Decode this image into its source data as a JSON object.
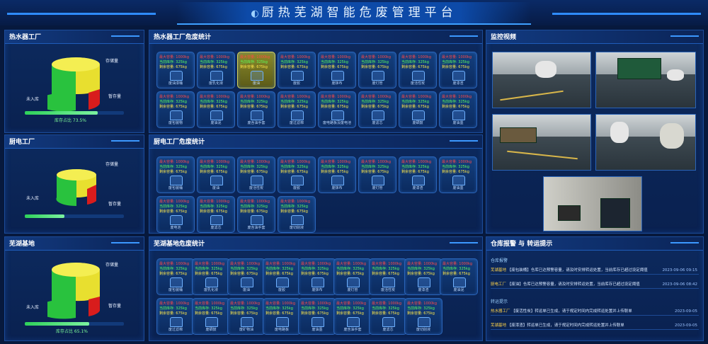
{
  "header": {
    "title": "厨热芜湖智能危废管理平台"
  },
  "panels": {
    "p1": {
      "title": "热水器工厂"
    },
    "p2": {
      "title": "厨电工厂"
    },
    "p3": {
      "title": "芜湖基地"
    },
    "p4": {
      "title": "热水器工厂危废统计"
    },
    "p5": {
      "title": "厨电工厂危废统计"
    },
    "p6": {
      "title": "芜湖基地危废统计"
    },
    "p7": {
      "title": "监控视频"
    },
    "p8": {
      "title": "仓库报警 与 转运提示"
    }
  },
  "pies": [
    {
      "gauge_label": "库存占比 73.5%",
      "gauge_pct": 73.5,
      "labels": [
        "存储量",
        "暂存量",
        "未入库"
      ]
    },
    {
      "gauge_label": "",
      "gauge_pct": 40,
      "labels": [
        "存储量",
        "暂存量",
        "未入库"
      ]
    },
    {
      "gauge_label": "库存占比 65.1%",
      "gauge_pct": 65.1,
      "labels": [
        "存储量",
        "暂存量",
        "未入库"
      ]
    }
  ],
  "tiles_p4": [
    {
      "name": "废油漆桶",
      "sel": false
    },
    {
      "name": "废乳化液",
      "sel": false
    },
    {
      "name": "废油",
      "sel": true
    },
    {
      "name": "废胶",
      "sel": false
    },
    {
      "name": "废抹布",
      "sel": false
    },
    {
      "name": "废灯管",
      "sel": false
    },
    {
      "name": "废活性炭",
      "sel": false
    },
    {
      "name": "废漆渣",
      "sel": false
    },
    {
      "name": "废包装物",
      "sel": false
    },
    {
      "name": "废油泥",
      "sel": false
    },
    {
      "name": "废含油手套",
      "sel": false
    },
    {
      "name": "废过滤棉",
      "sel": false
    },
    {
      "name": "废电路板及废电池",
      "sel": false
    },
    {
      "name": "废滤芯",
      "sel": false
    },
    {
      "name": "废硒鼓",
      "sel": false
    },
    {
      "name": "废油墨",
      "sel": false
    }
  ],
  "tiles_p5": [
    {
      "name": "废包装桶"
    },
    {
      "name": "废油"
    },
    {
      "name": "废活性炭"
    },
    {
      "name": "废胶"
    },
    {
      "name": "废抹布"
    },
    {
      "name": "废灯管"
    },
    {
      "name": "废漆渣"
    },
    {
      "name": "废油墨"
    },
    {
      "name": "废电池"
    },
    {
      "name": "废滤芯"
    },
    {
      "name": "废含油手套"
    },
    {
      "name": "废切削液"
    }
  ],
  "tiles_p6": [
    {
      "name": "废包装桶"
    },
    {
      "name": "废乳化液"
    },
    {
      "name": "废油"
    },
    {
      "name": "废胶"
    },
    {
      "name": "废抹布"
    },
    {
      "name": "废灯管"
    },
    {
      "name": "废活性炭"
    },
    {
      "name": "废漆渣"
    },
    {
      "name": "废油泥"
    },
    {
      "name": "废过滤棉"
    },
    {
      "name": "废硒鼓"
    },
    {
      "name": "废矿物油"
    },
    {
      "name": "废电路板"
    },
    {
      "name": "废油墨"
    },
    {
      "name": "废含油手套"
    },
    {
      "name": "废滤芯"
    },
    {
      "name": "废切削液"
    }
  ],
  "tile_lines": {
    "l1": "最大容量: 1000kg",
    "l2": "当前库存: 325kg",
    "l3": "剩余容量: 675kg"
  },
  "alarm": {
    "sec1": "仓库报警",
    "sec2": "转运提示",
    "rows1": [
      {
        "tag": "芜湖基地",
        "text": "【废包装桶】仓库已达预警容量，请及时安排转运处置，当前库存已超过设定阈值",
        "ts": "2023-09-06 09:15"
      },
      {
        "tag": "厨电工厂",
        "text": "【废油】仓库已达预警容量，请及时安排转运处置，当前库存已超过设定阈值",
        "ts": "2023-09-06 08:42"
      }
    ],
    "rows2": [
      {
        "tag": "热水器工厂",
        "text": "【废活性炭】转运单已生成，请于规定时间内完成转运处置并上传联单",
        "ts": "2023-09-05"
      },
      {
        "tag": "芜湖基地",
        "text": "【废漆渣】转运单已生成，请于规定时间内完成转运处置并上传联单",
        "ts": "2023-09-05"
      }
    ]
  },
  "colors": {
    "bg": "#07193d",
    "accent": "#3ea0ff",
    "green": "#2ed15a",
    "yellow": "#f2e83a",
    "red": "#e02020"
  }
}
